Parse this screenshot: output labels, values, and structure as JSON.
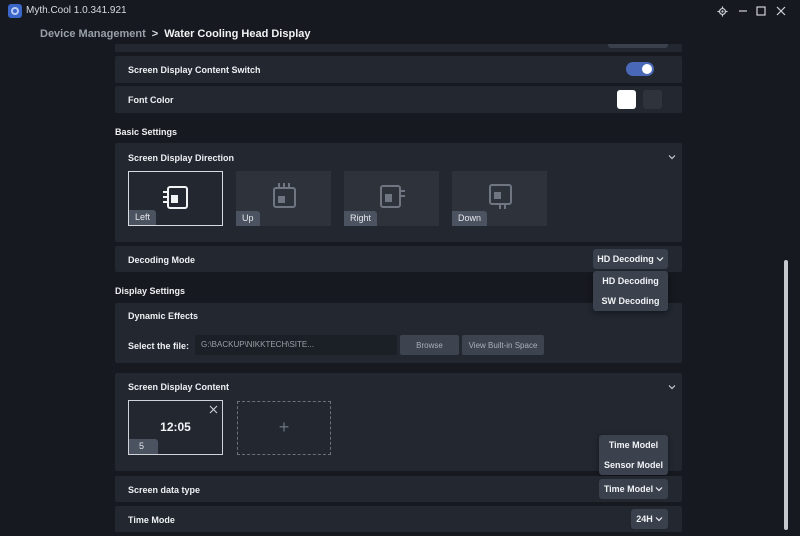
{
  "app": {
    "title": "Myth.Cool  1.0.341.921"
  },
  "breadcrumb": {
    "parent": "Device Management",
    "separator": ">",
    "current": "Water Cooling Head Display"
  },
  "display_switch": {
    "label": "Screen Display Content Switch",
    "enabled": true
  },
  "font_color": {
    "label": "Font Color",
    "options": [
      "#ffffff",
      "#2e333c"
    ],
    "selected": "#ffffff"
  },
  "basic_settings": {
    "title": "Basic Settings",
    "direction": {
      "label": "Screen Display Direction",
      "options": [
        "Left",
        "Up",
        "Right",
        "Down"
      ],
      "selected": "Left"
    },
    "decoding": {
      "label": "Decoding Mode",
      "value": "HD Decoding",
      "options": [
        "HD Decoding",
        "SW Decoding"
      ]
    }
  },
  "display_settings": {
    "title": "Display Settings",
    "dynamic_effects": {
      "label": "Dynamic Effects",
      "file_label": "Select the file:",
      "file_value": "G:\\BACKUP\\NIKKTECH\\SITE...",
      "browse_label": "Browse",
      "builtin_label": "View Built-in Space"
    },
    "content": {
      "label": "Screen Display Content",
      "card_time": "12:05",
      "card_index": "5",
      "add_symbol": "+"
    },
    "data_type": {
      "label": "Screen data type",
      "value": "Time Model",
      "options": [
        "Time Model",
        "Sensor Model"
      ]
    },
    "time_mode": {
      "label": "Time Mode",
      "value": "24H"
    }
  },
  "colors": {
    "accent": "#4a68b8",
    "panel": "#222730",
    "background": "#16191f"
  }
}
